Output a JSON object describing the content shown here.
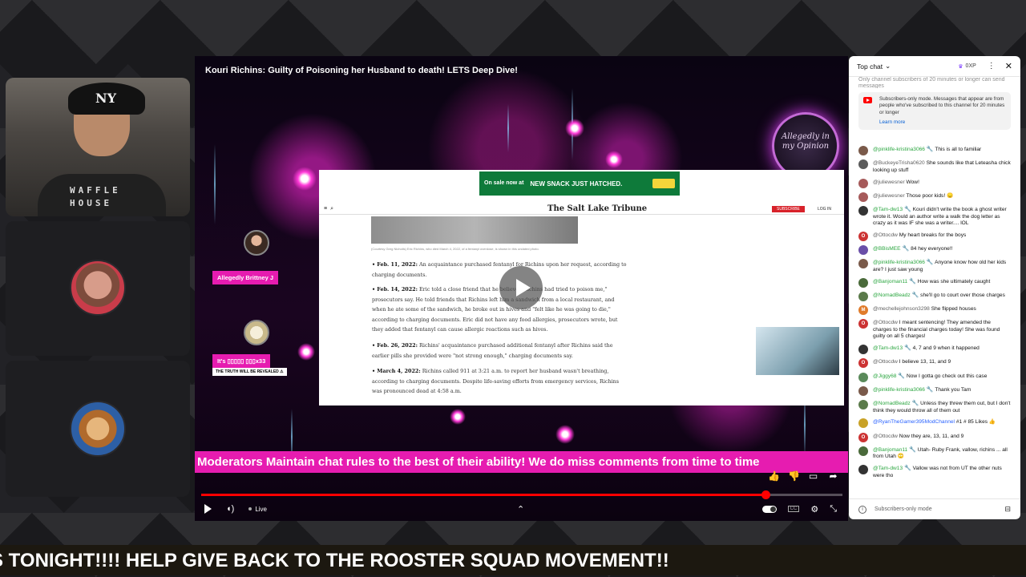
{
  "video": {
    "title": "Kouri Richins: Guilty of Poisoning her Husband to death!  LETS Deep Dive!",
    "live_label": "Live",
    "logo_text": "Allegedly in my Opinion",
    "guests": [
      {
        "label": "Allegedly Brittney J"
      },
      {
        "label": "It's ▯▯▯▯▯ ▯▯▯x33",
        "sub": "THE TRUTH WILL BE REVEALED ⚠"
      }
    ],
    "mod_ticker": "Moderators Maintain chat rules to the best of their ability! We do miss comments from time to time",
    "progress_fraction": 0.88
  },
  "article": {
    "ad_left": "On sale now at",
    "ad_main": "NEW SNACK JUST HATCHED.",
    "masthead": "The Salt Lake Tribune",
    "subscribe": "SUBSCRIBE",
    "login": "LOG IN",
    "caption": "(Courtesy Greg Nicholls) Eric Richins, who died March 4, 2022, of a fentanyl overdose, is shown in this undated photo.",
    "paragraphs": [
      {
        "date": "• Feb. 11, 2022:",
        "text": " An acquaintance purchased fentanyl for Richins upon her request, according to charging documents."
      },
      {
        "date": "• Feb. 14, 2022:",
        "text": " Eric told a close friend that he believed Richins had tried to poison me,\" prosecutors say. He told friends that Richins left him a sandwich from a local restaurant, and when he ate some of the sandwich, he broke out in hives and \"felt like he was going to die,\" according to charging documents. Eric did not have any food allergies, prosecutors wrote, but they added that fentanyl can cause allergic reactions such as hives."
      },
      {
        "date": "• Feb. 26, 2022:",
        "text": " Richins' acquaintance purchased additional fentanyl after Richins said the earlier pills she provided were \"not strong enough,\" charging documents say."
      },
      {
        "date": "• March 4, 2022:",
        "text": " Richins called 911 at 3:21 a.m. to report her husband wasn't breathing, according to charging documents. Despite life-saving efforts from emergency services, Richins was pronounced dead at 4:58 a.m."
      }
    ]
  },
  "cams": {
    "host_cap": "NY",
    "host_shirt_1": "WAFFLE",
    "host_shirt_2": "HOUSE"
  },
  "chat": {
    "title": "Top chat",
    "xp": "0XP",
    "faded_banner": "Only channel subscribers of 20 minutes or longer can send messages",
    "notice": "Subscribers-only mode. Messages that appear are from people who've subscribed to this channel for 20 minutes or longer",
    "learn_more": "Learn more",
    "footer_placeholder": "Subscribers-only mode",
    "messages": [
      {
        "author": "@pinklife-kristina3066",
        "style": "green",
        "mod": true,
        "text": "This is all to familiar",
        "avatar_color": "#7a5a4a"
      },
      {
        "author": "@BuckeyeTrisha0620",
        "style": "plain",
        "mod": false,
        "text": "She sounds like that Leteasha chick looking up stuff",
        "avatar_color": "#5b5b5b"
      },
      {
        "author": "@juliewesner",
        "style": "plain",
        "mod": false,
        "text": "Wow!",
        "avatar_color": "#a65a5a"
      },
      {
        "author": "@juliewesner",
        "style": "plain",
        "mod": false,
        "text": "Those poor kids! 😞",
        "avatar_color": "#a65a5a"
      },
      {
        "author": "@Tam-dw13",
        "style": "green",
        "mod": true,
        "text": "Kouri didn't write the book a ghost writer wrote it. Would an author write a walk the dog letter as crazy as it was IF she was a writer.... lOL",
        "avatar_color": "#333333"
      },
      {
        "author": "@Ottocdw",
        "style": "plain",
        "mod": false,
        "text": "My heart breaks for the boys",
        "avatar_color": "#cc3333",
        "initial": "O"
      },
      {
        "author": "@BBisMEE",
        "style": "green",
        "mod": true,
        "text": "84 hey everyone!!",
        "avatar_color": "#6a4fa8"
      },
      {
        "author": "@pinklife-kristina3066",
        "style": "green",
        "mod": true,
        "text": "Anyone know how old her kids are? I just saw young",
        "avatar_color": "#7a5a4a"
      },
      {
        "author": "@Banjoman11",
        "style": "green",
        "mod": true,
        "text": "How was she ultimately caught",
        "avatar_color": "#4a6a3a"
      },
      {
        "author": "@NomadBeadz",
        "style": "green",
        "mod": true,
        "text": "she'll go to court over those charges",
        "avatar_color": "#5a7a4a"
      },
      {
        "author": "@mechellejohnson3298",
        "style": "plain",
        "mod": false,
        "text": "She flipped houses",
        "avatar_color": "#e07b2a",
        "initial": "M"
      },
      {
        "author": "@Ottocdw",
        "style": "plain",
        "mod": false,
        "text": "I meant sentencing! They amended the charges to the financial charges today! She was found guilty on all 5 charges!",
        "avatar_color": "#cc3333",
        "initial": "O"
      },
      {
        "author": "@Tam-dw13",
        "style": "green",
        "mod": true,
        "text": "4, 7 and 9 when it happened",
        "avatar_color": "#333333"
      },
      {
        "author": "@Ottocdw",
        "style": "plain",
        "mod": false,
        "text": "I believe 13, 11, and 9",
        "avatar_color": "#cc3333",
        "initial": "O"
      },
      {
        "author": "@Jiggy68",
        "style": "green",
        "mod": true,
        "text": "Now I gotta go check out this case",
        "avatar_color": "#5a8a5a"
      },
      {
        "author": "@pinklife-kristina3066",
        "style": "green",
        "mod": true,
        "text": "Thank you Tam",
        "avatar_color": "#7a5a4a"
      },
      {
        "author": "@NomadBeadz",
        "style": "green",
        "mod": true,
        "text": "Unless they threw them out, but I don't think they would throw all of them out",
        "avatar_color": "#5a7a4a"
      },
      {
        "author": "@RyanTheGamer395ModChannel",
        "style": "blue",
        "mod": false,
        "text": "#1 # 85 Likes 👍",
        "avatar_color": "#c9a227"
      },
      {
        "author": "@Ottocdw",
        "style": "plain",
        "mod": false,
        "text": "Now they are, 13, 11, and 9",
        "avatar_color": "#cc3333",
        "initial": "O"
      },
      {
        "author": "@Banjoman11",
        "style": "green",
        "mod": true,
        "text": "Utah- Ruby Frank, vallow, richins ... all from Utah 🙄",
        "avatar_color": "#4a6a3a"
      },
      {
        "author": "@Tam-dw13",
        "style": "green",
        "mod": true,
        "text": "Vallow was not from UT the other nuts were tho",
        "avatar_color": "#333333"
      }
    ]
  },
  "bottom_ticker": "S TONIGHT!!!! HELP GIVE BACK TO THE ROOSTER SQUAD MOVEMENT!!"
}
